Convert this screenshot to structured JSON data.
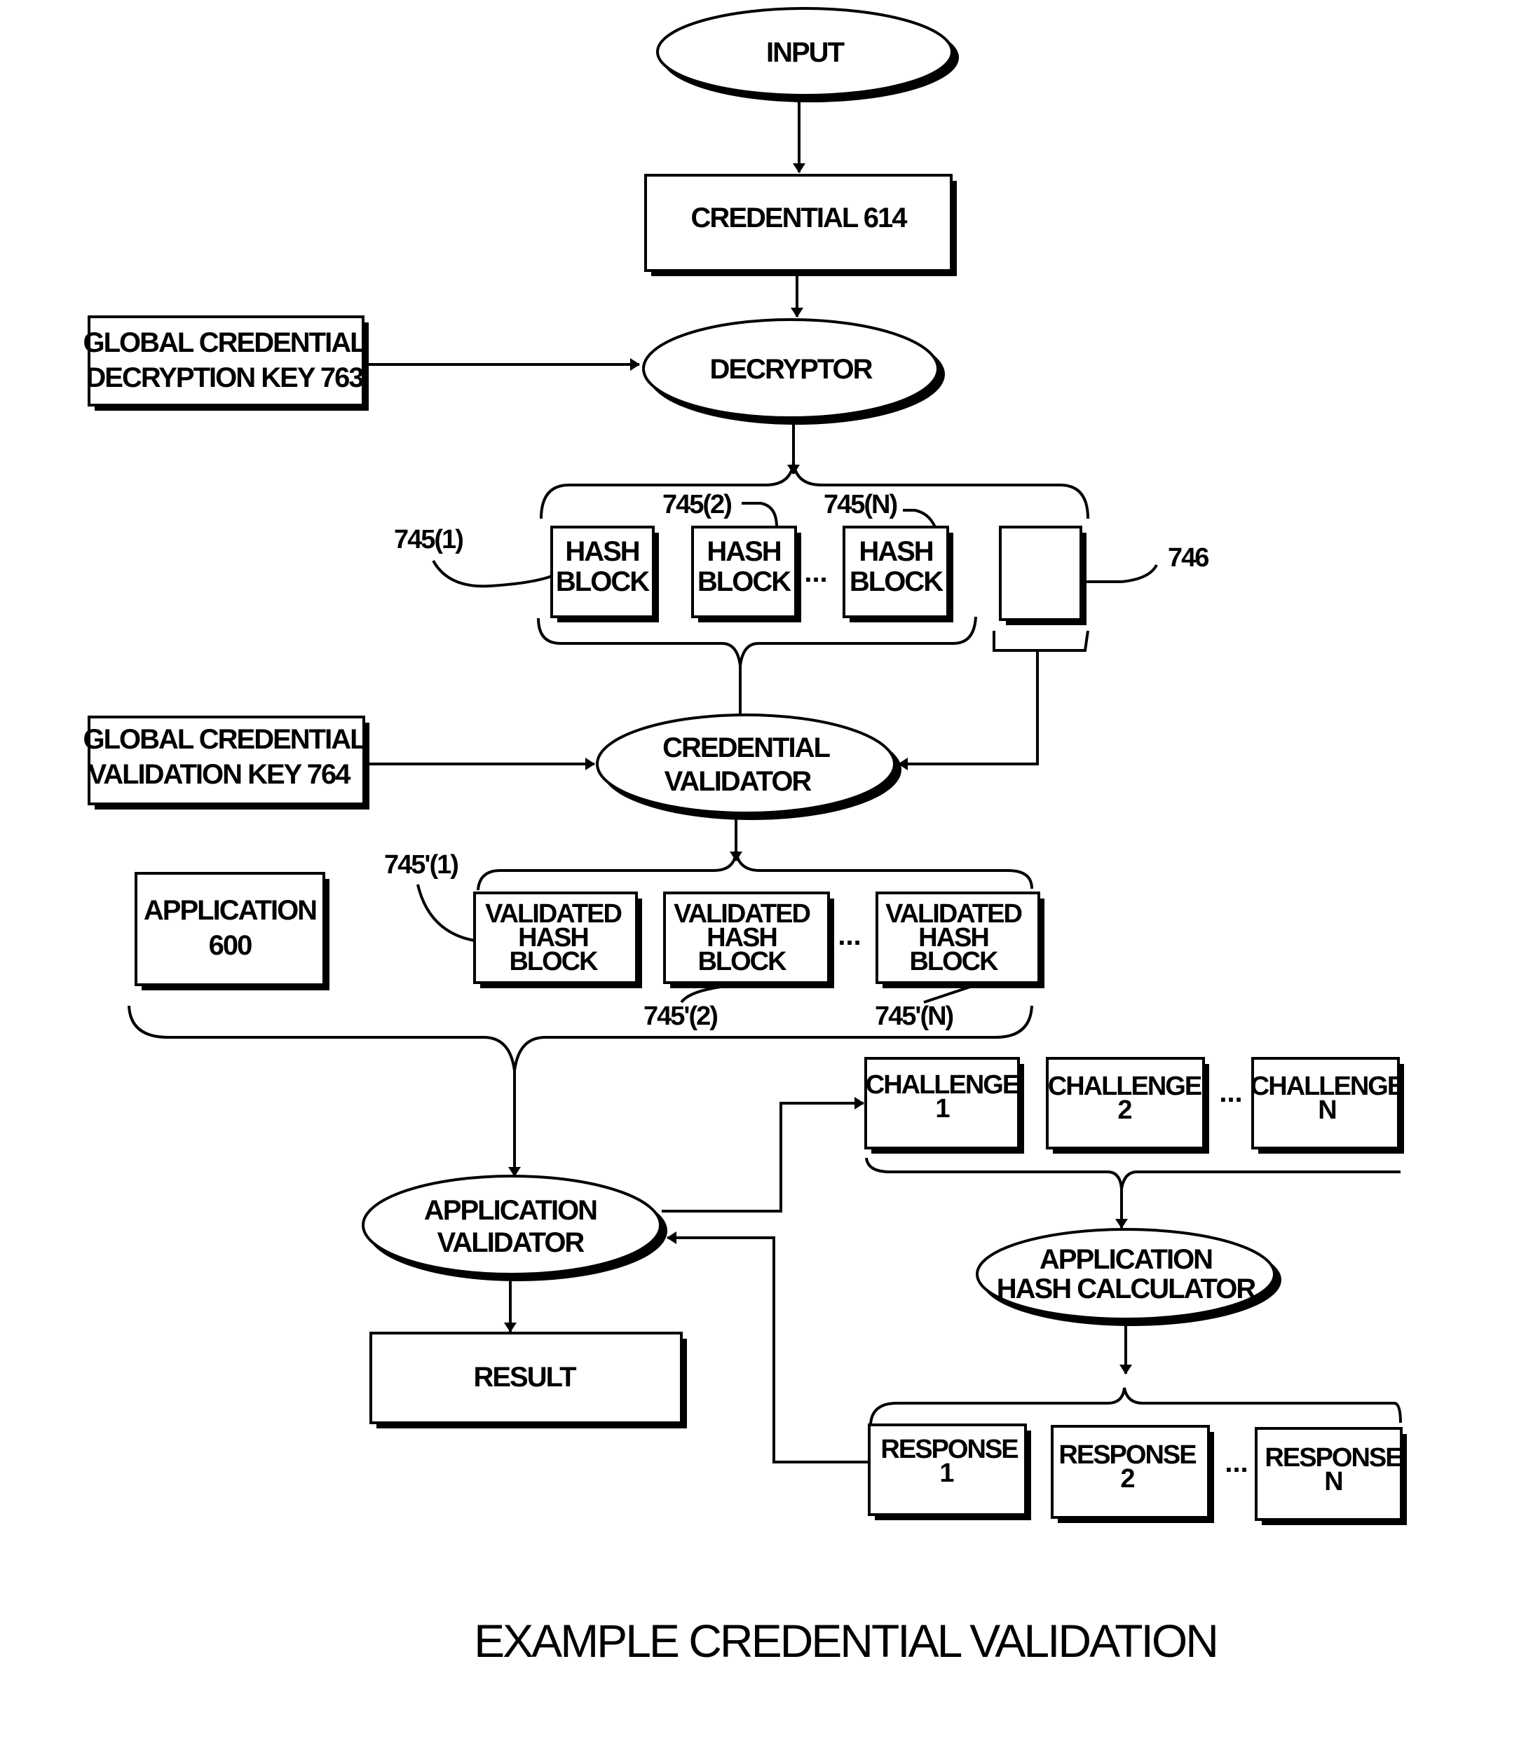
{
  "figure": {
    "title": "EXAMPLE CREDENTIAL VALIDATION"
  },
  "nodes": {
    "input": "INPUT",
    "credential": "CREDENTIAL 614",
    "global_decryption_key": [
      "GLOBAL CREDENTIAL",
      "DECRYPTION KEY 763"
    ],
    "decryptor": "DECRYPTOR",
    "hash_blocks": [
      {
        "line1": "HASH",
        "line2": "BLOCK",
        "ref": "745(1)"
      },
      {
        "line1": "HASH",
        "line2": "BLOCK",
        "ref": "745(2)"
      },
      {
        "line1": "HASH",
        "line2": "BLOCK",
        "ref": "745(N)"
      }
    ],
    "signature_block_ref": "746",
    "global_validation_key": [
      "GLOBAL CREDENTIAL",
      "VALIDATION KEY 764"
    ],
    "credential_validator": [
      "CREDENTIAL",
      "VALIDATOR"
    ],
    "application": [
      "APPLICATION",
      "600"
    ],
    "validated_hash_blocks": [
      {
        "lines": [
          "VALIDATED",
          "HASH",
          "BLOCK"
        ],
        "ref": "745'(1)"
      },
      {
        "lines": [
          "VALIDATED",
          "HASH",
          "BLOCK"
        ],
        "ref": "745'(2)"
      },
      {
        "lines": [
          "VALIDATED",
          "HASH",
          "BLOCK"
        ],
        "ref": "745'(N)"
      }
    ],
    "application_validator": [
      "APPLICATION",
      "VALIDATOR"
    ],
    "result": "RESULT",
    "challenges": [
      {
        "line1": "CHALLENGE",
        "line2": "1"
      },
      {
        "line1": "CHALLENGE",
        "line2": "2"
      },
      {
        "line1": "CHALLENGE",
        "line2": "N"
      }
    ],
    "application_hash_calculator": [
      "APPLICATION",
      "HASH CALCULATOR"
    ],
    "responses": [
      {
        "line1": "RESPONSE",
        "line2": "1"
      },
      {
        "line1": "RESPONSE",
        "line2": "2"
      },
      {
        "line1": "RESPONSE",
        "line2": "N"
      }
    ],
    "ellipsis": "..."
  }
}
